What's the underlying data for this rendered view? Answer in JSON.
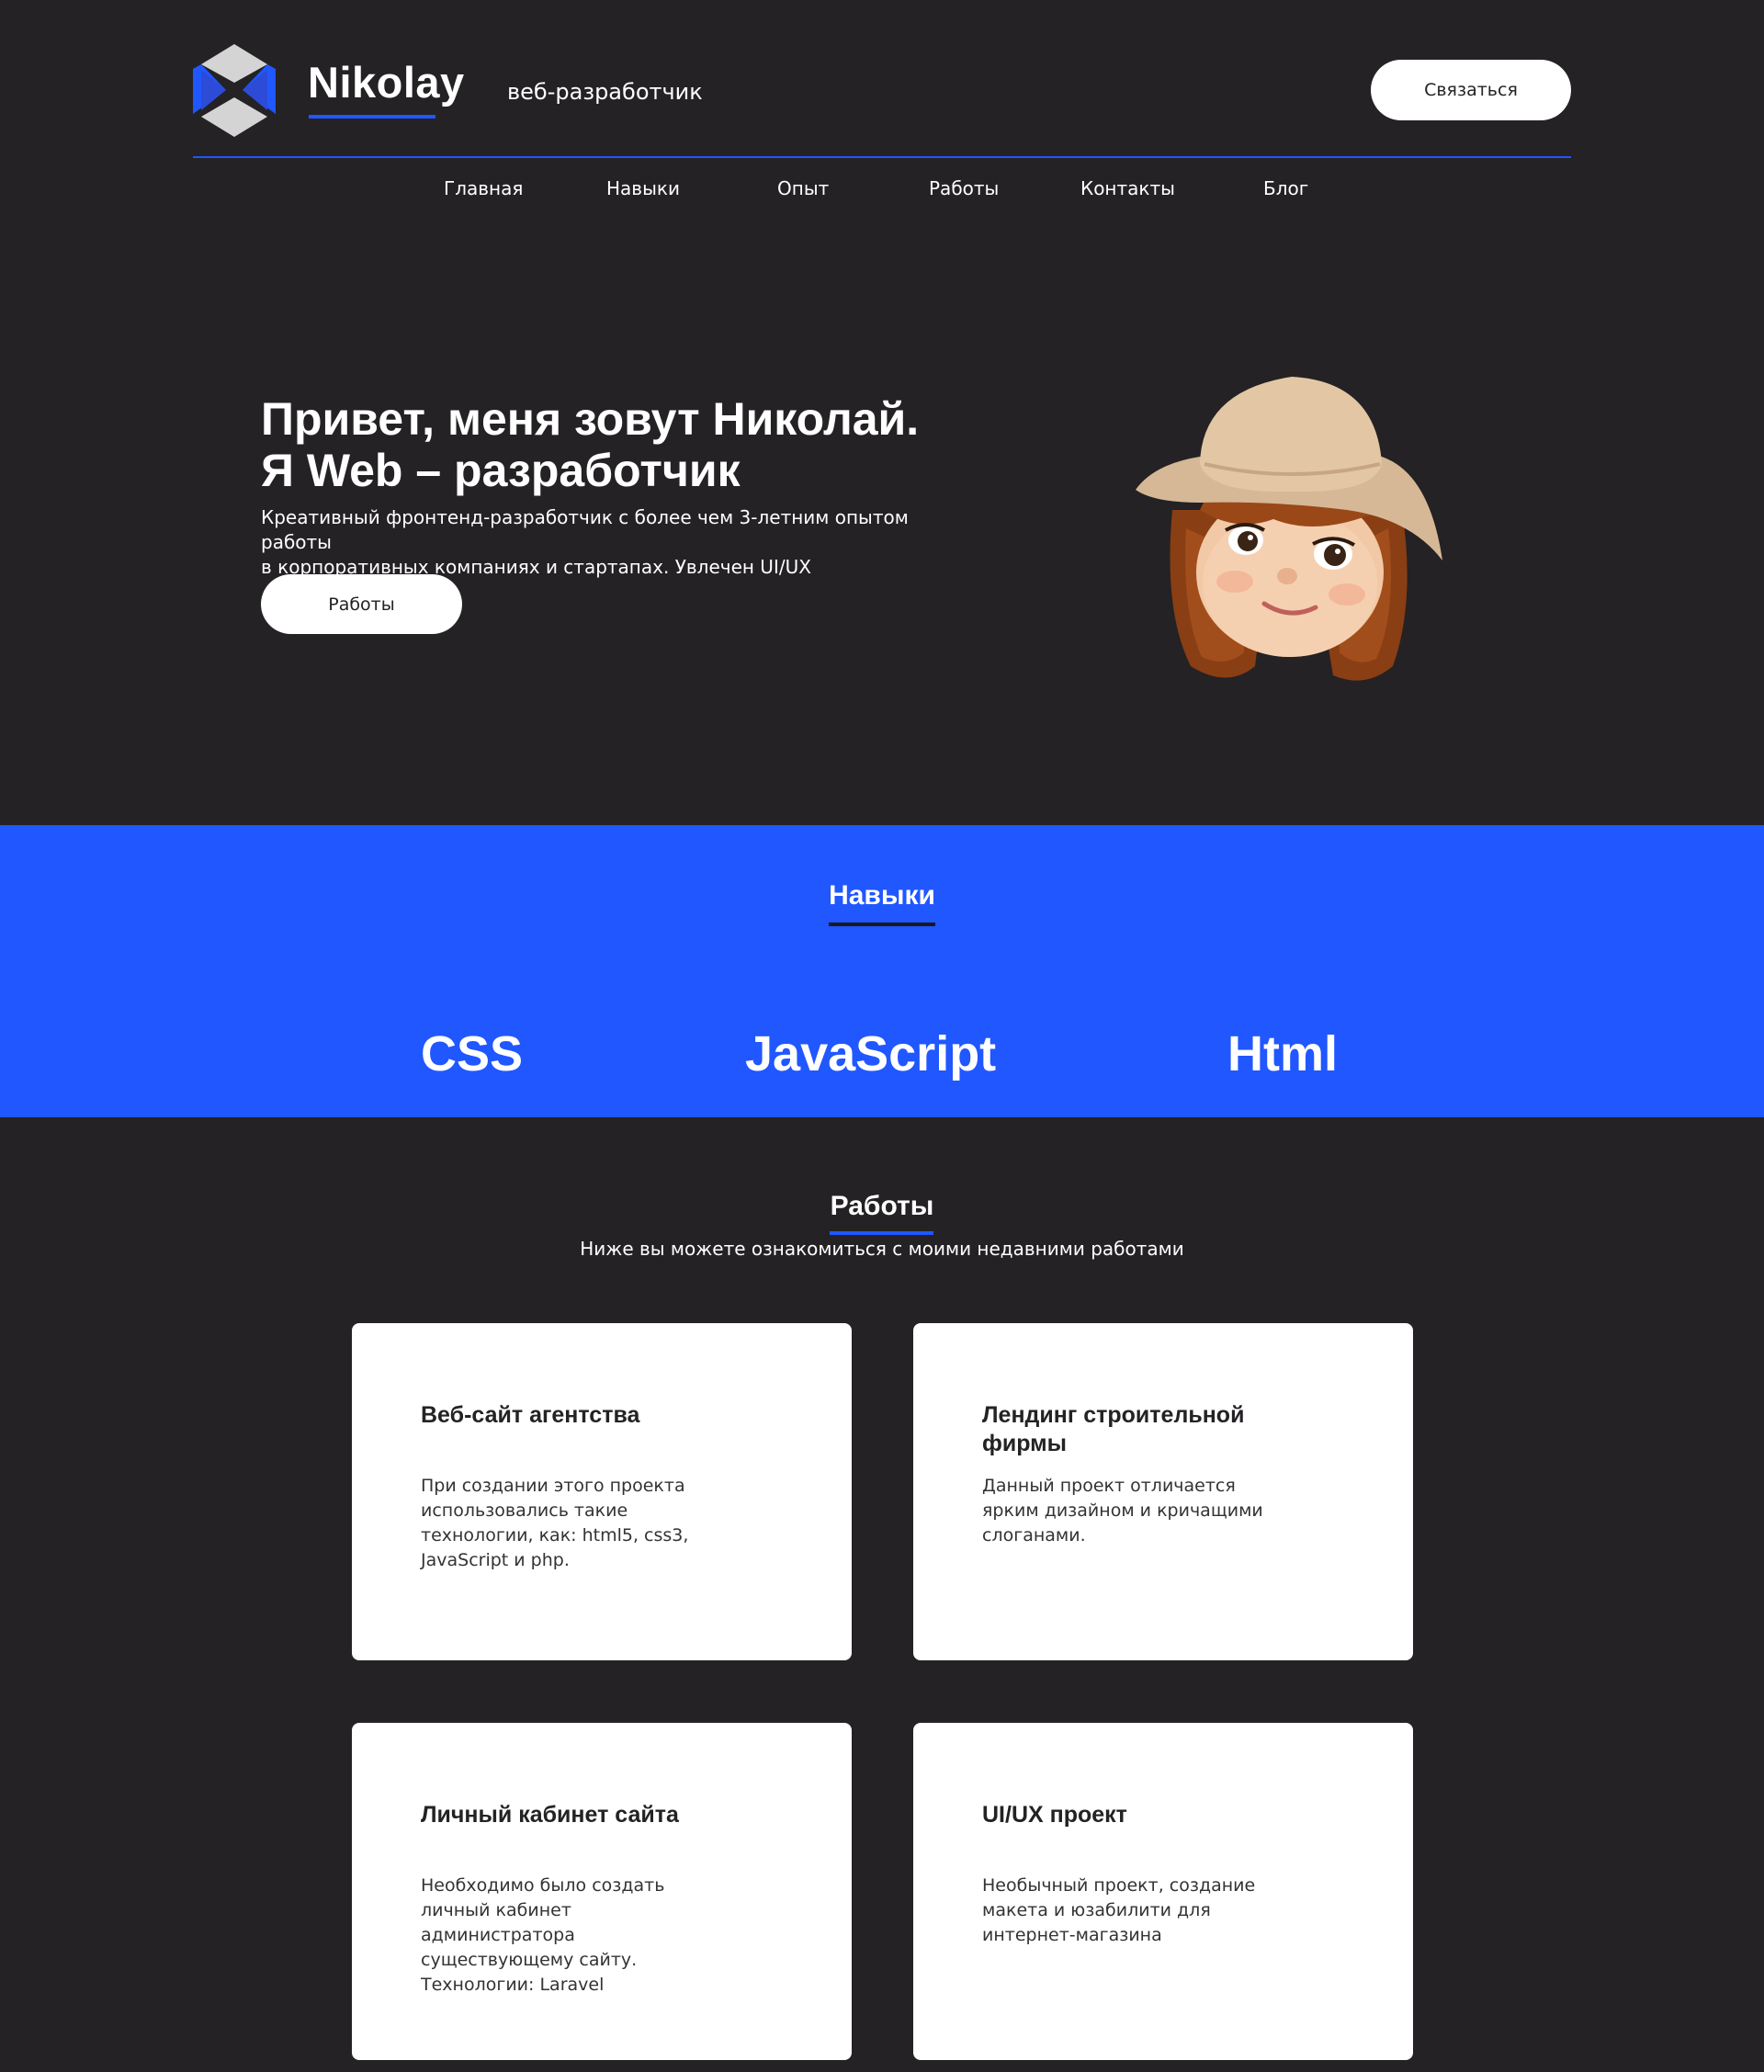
{
  "header": {
    "logo_name": "Nikolay",
    "tagline": "веб-разработчик",
    "contact_label": "Связаться"
  },
  "nav": {
    "items": [
      "Главная",
      "Навыки",
      "Опыт",
      "Работы",
      "Контакты",
      "Блог"
    ]
  },
  "hero": {
    "title_line1": "Привет, меня зовут Николай.",
    "title_line2": "Я Web – разработчик",
    "text_line1": "Креативный фронтенд-разработчик с более чем 3-летним опытом работы",
    "text_line2": "в корпоративных компаниях и стартапах. Увлечен UI/UX",
    "button_label": "Работы"
  },
  "skills": {
    "title": "Навыки",
    "items": [
      "CSS",
      "JavaScript",
      "Html"
    ]
  },
  "works": {
    "title": "Работы",
    "subtitle": "Ниже вы можете ознакомиться с моими недавними работами",
    "cards": [
      {
        "title": "Веб-сайт агентства",
        "text": "При создании этого проекта использовались такие технологии, как: html5, css3, JavaScript и php."
      },
      {
        "title": "Лендинг строительной фирмы",
        "text": "Данный проект отличается ярким дизайном и кричащими слоганами."
      },
      {
        "title": "Личный кабинет сайта",
        "text": "Необходимо было создать личный кабинет администратора существующему сайту. Технологии: Laravel"
      },
      {
        "title": "UI/UX проект",
        "text": "Необычный проект, создание макета и юзабилити для интернет-магазина"
      }
    ]
  },
  "colors": {
    "background": "#242224",
    "accent": "#2057ff",
    "card": "#ffffff"
  },
  "icons": {
    "logo": "hexagon-logo-icon",
    "avatar": "memoji-avatar-icon"
  }
}
